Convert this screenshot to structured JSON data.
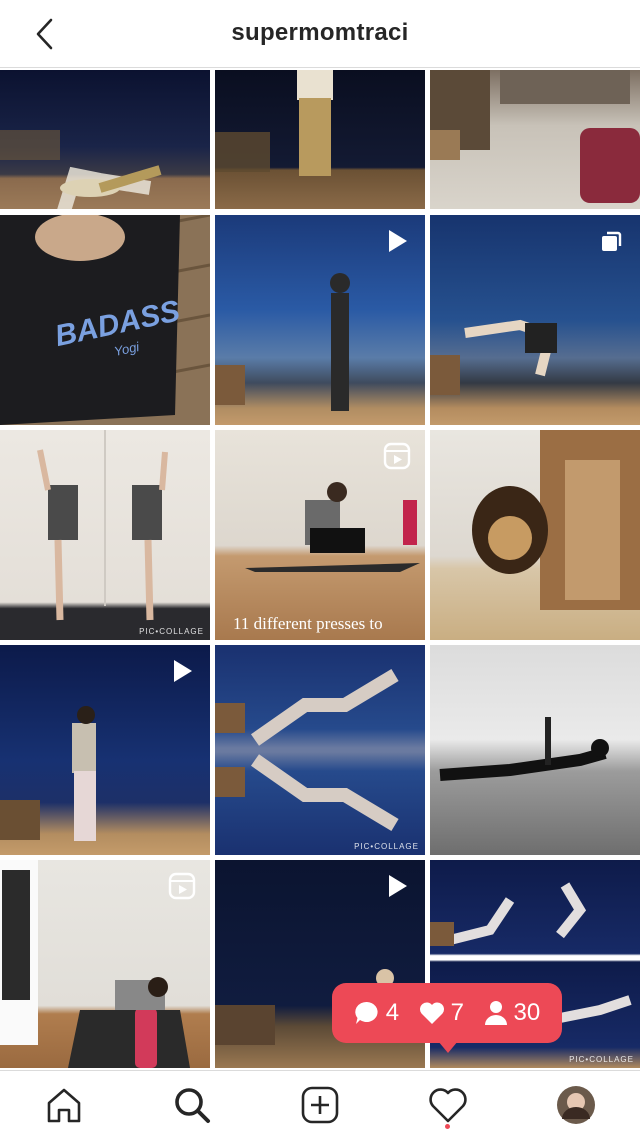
{
  "header": {
    "title": "supermomtraci",
    "back_icon": "chevron-left-icon"
  },
  "grid": {
    "tiles": [
      {
        "badge": "none"
      },
      {
        "badge": "none"
      },
      {
        "badge": "none"
      },
      {
        "badge": "none",
        "shirt_text": "BADASS",
        "shirt_sub": "Yogi"
      },
      {
        "badge": "video"
      },
      {
        "badge": "carousel"
      },
      {
        "badge": "none",
        "watermark": "PIC•COLLAGE"
      },
      {
        "badge": "reel",
        "caption": "11 different presses to"
      },
      {
        "badge": "none"
      },
      {
        "badge": "video"
      },
      {
        "badge": "none",
        "watermark": "PIC•COLLAGE"
      },
      {
        "badge": "none"
      },
      {
        "badge": "reel"
      },
      {
        "badge": "video"
      },
      {
        "badge": "none",
        "watermark": "PIC•COLLAGE"
      }
    ]
  },
  "activity": {
    "comments": "4",
    "likes": "7",
    "follows": "30",
    "color": "#ed4956"
  },
  "nav": {
    "items": [
      "home-icon",
      "search-icon",
      "new-post-icon",
      "activity-heart-icon",
      "profile-avatar"
    ]
  }
}
